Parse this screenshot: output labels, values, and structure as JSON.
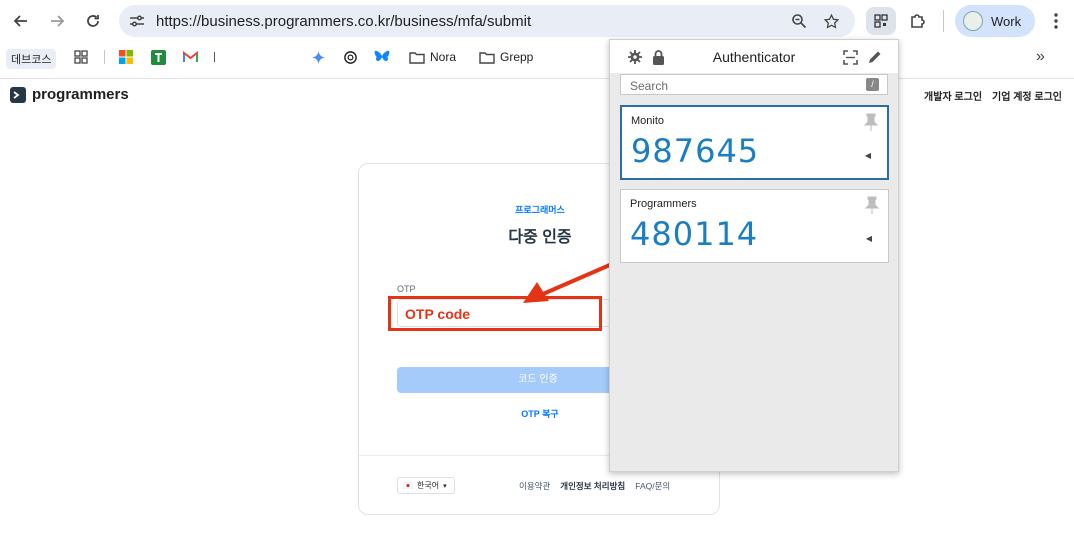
{
  "browser": {
    "url": "https://business.programmers.co.kr/business/mfa/submit",
    "profile_label": "Work",
    "bookmarks": [
      {
        "label": "데브코스",
        "icon": "folder-chip"
      },
      {
        "label": "",
        "icon": "apps-grid-icon"
      },
      {
        "label": "",
        "icon": "microsoft-icon"
      },
      {
        "label": "",
        "icon": "sheets-icon"
      },
      {
        "label": "",
        "icon": "gmail-icon"
      },
      {
        "label": "",
        "icon": "gemini-icon"
      },
      {
        "label": "",
        "icon": "openai-icon"
      },
      {
        "label": "",
        "icon": "bluesky-icon"
      },
      {
        "label": "Nora",
        "icon": "folder-icon"
      },
      {
        "label": "Grepp",
        "icon": "folder-icon"
      }
    ]
  },
  "site": {
    "logo_text": "programmers",
    "header_links": [
      "개발자 로그인",
      "기업 계정 로그인"
    ]
  },
  "mfa_card": {
    "kicker": "프로그래머스",
    "title": "다중 인증",
    "otp_label": "OTP",
    "otp_value": "",
    "verify_button": "코드 인증",
    "recover_link": "OTP 복구",
    "language": "한국어",
    "footer_links": [
      "이용약관",
      "개인정보 처리방침",
      "FAQ/문의"
    ]
  },
  "annotation": {
    "label": "OTP code",
    "color": "#e53316"
  },
  "authenticator": {
    "title": "Authenticator",
    "search_placeholder": "Search",
    "search_shortcut": "/",
    "entries": [
      {
        "issuer": "Monito",
        "code": "987645",
        "active": true
      },
      {
        "issuer": "Programmers",
        "code": "480114",
        "active": false
      }
    ]
  },
  "colors": {
    "accent_blue": "#0078ff",
    "code_blue": "#1a7ec1",
    "button_disabled": "#a4cbfa"
  }
}
